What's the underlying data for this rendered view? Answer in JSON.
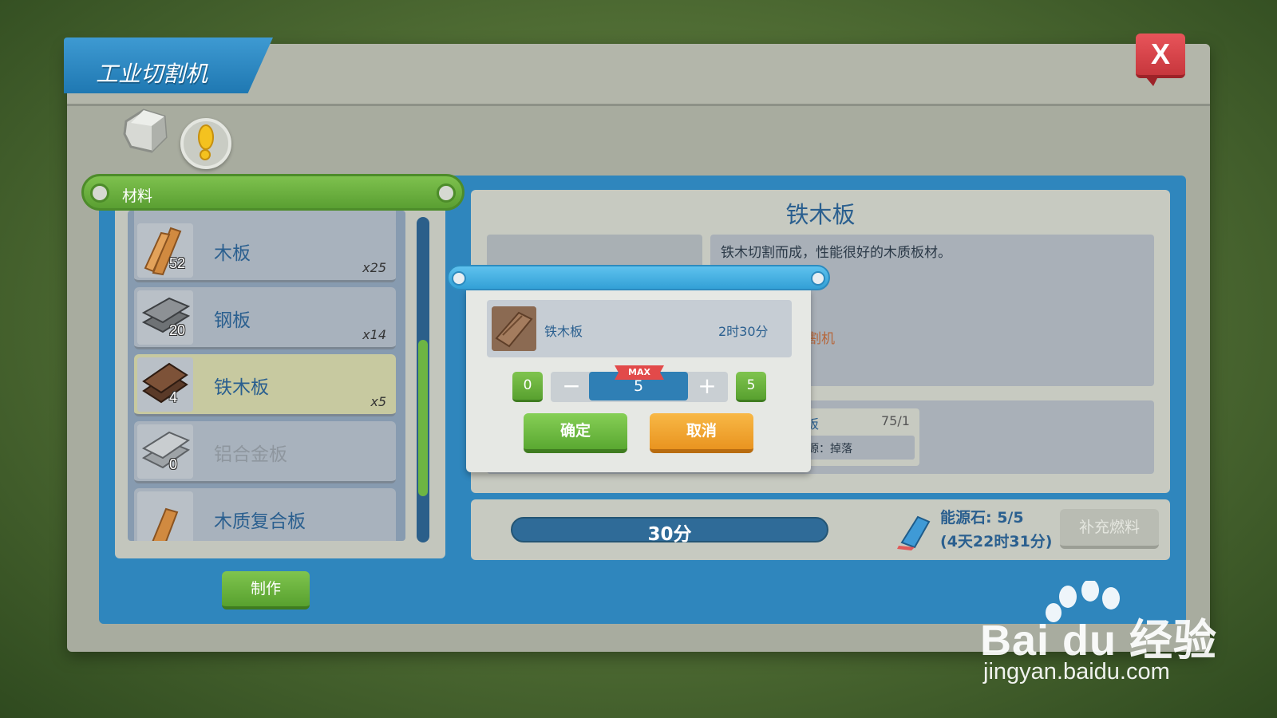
{
  "window": {
    "title": "工业切割机",
    "close_label": "X"
  },
  "materials": {
    "header": "材料",
    "items": [
      {
        "name": "木板",
        "count": "52",
        "qty": "x25",
        "state": "normal"
      },
      {
        "name": "钢板",
        "count": "20",
        "qty": "x14",
        "state": "normal"
      },
      {
        "name": "铁木板",
        "count": "4",
        "qty": "x5",
        "state": "selected"
      },
      {
        "name": "铝合金板",
        "count": "0",
        "qty": "",
        "state": "disabled"
      },
      {
        "name": "木质复合板",
        "count": "",
        "qty": "",
        "state": "normal"
      }
    ],
    "make_label": "制作"
  },
  "detail": {
    "title": "铁木板",
    "description": "铁木切割而成，性能很好的木质板材。",
    "description_extra": "割机",
    "requirement": {
      "name": "板",
      "count": "75/1",
      "source": "源：掉落"
    },
    "progress_label": "30分",
    "energy": {
      "line1": "能源石: 5/5",
      "line2": "(4天22时31分)"
    },
    "refuel_label": "补充燃料"
  },
  "dialog": {
    "item_name": "铁木板",
    "time": "2时30分",
    "min": "0",
    "max": "5",
    "value": "5",
    "max_badge": "MAX",
    "minus": "−",
    "plus": "+",
    "confirm_label": "确定",
    "cancel_label": "取消"
  },
  "watermark": {
    "brand": "Bai du 经验",
    "url": "jingyan.baidu.com"
  },
  "colors": {
    "accent_blue": "#2f86bd",
    "green": "#6db543",
    "orange": "#f0a030",
    "close_red": "#d9434a"
  }
}
